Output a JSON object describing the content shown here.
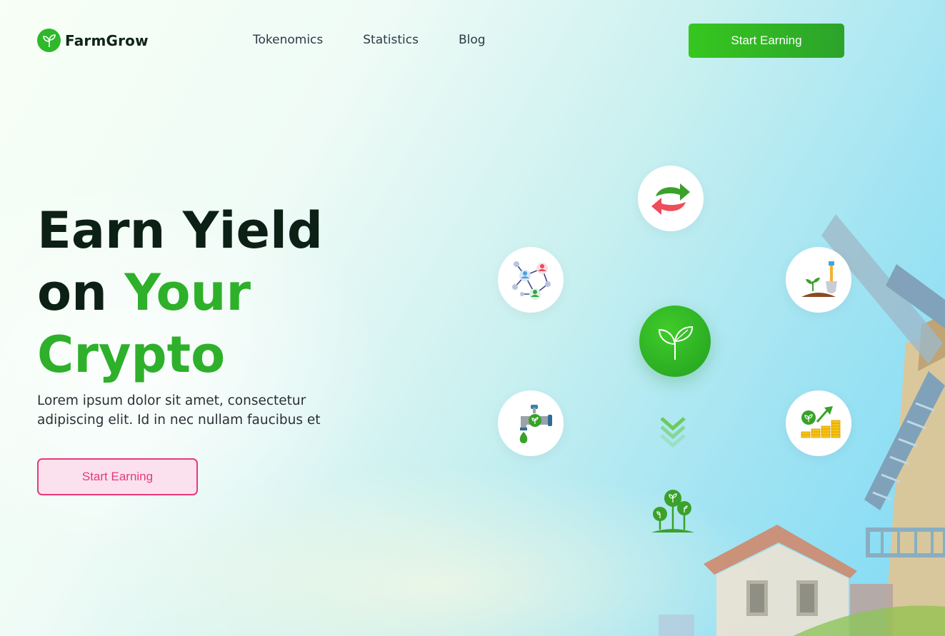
{
  "brand": {
    "name": "FarmGrow",
    "logo_icon": "sprout-icon"
  },
  "nav": {
    "links": [
      "Tokenomics",
      "Statistics",
      "Blog"
    ],
    "cta_label": "Start Earning"
  },
  "hero": {
    "title_line1": "Earn Yield",
    "title_line2_a": "on ",
    "title_line2_b": "Your",
    "title_line3": "Crypto",
    "description": "Lorem ipsum dolor sit amet, consectetur adipiscing elit. Id in nec nullam faucibus et",
    "cta_label": "Start Earning"
  },
  "feature_icons": [
    "swap-arrows-icon",
    "network-users-icon",
    "planting-shovel-icon",
    "growth-sprout-icon",
    "faucet-drip-icon",
    "coins-growth-icon",
    "double-chevron-down-icon",
    "plants-icon"
  ],
  "colors": {
    "brand_green": "#2eb02a",
    "accent_pink": "#e33a7b",
    "text_dark": "#0c2016"
  }
}
